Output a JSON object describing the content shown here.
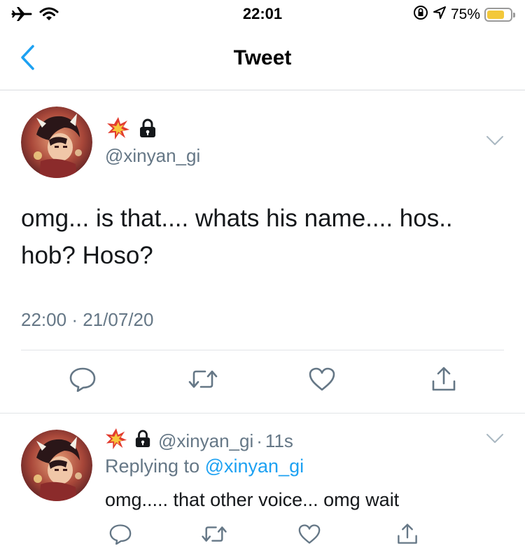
{
  "status_bar": {
    "time": "22:01",
    "battery_percent": "75%",
    "battery_level": 0.75,
    "icons": [
      "airplane-icon",
      "wifi-icon",
      "rotation-lock-icon",
      "location-icon",
      "battery-icon"
    ]
  },
  "nav": {
    "title": "Tweet",
    "back_icon": "chevron-left-icon"
  },
  "main_tweet": {
    "handle": "@xinyan_gi",
    "text_line1": "omg... is that.... whats his name.... hos..",
    "text_line2": "hob? Hoso?",
    "time": "22:00",
    "separator": "·",
    "date": "21/07/20",
    "badges": [
      "collision-emoji",
      "lock-icon"
    ]
  },
  "reply_tweet": {
    "handle": "@xinyan_gi",
    "separator": "·",
    "age": "11s",
    "replying_prefix": "Replying to",
    "replying_to": "@xinyan_gi",
    "text": "omg..... that other voice... omg wait"
  },
  "actions": [
    "reply-icon",
    "retweet-icon",
    "like-icon",
    "share-icon"
  ],
  "colors": {
    "accent": "#1da1f2",
    "secondary_text": "#657786",
    "primary_text": "#14171a",
    "battery": "#f3c83a"
  }
}
